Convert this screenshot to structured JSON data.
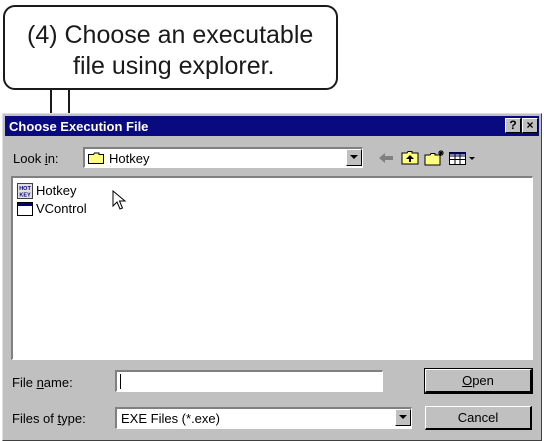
{
  "callout": {
    "line1": "(4)  Choose  an  executable",
    "line2": "file using explorer."
  },
  "dialog": {
    "title": "Choose Execution File",
    "help_button": "?",
    "close_button": "×",
    "lookin_label_pre": "Look ",
    "lookin_label_key": "i",
    "lookin_label_post": "n:",
    "lookin_value": "Hotkey",
    "files": [
      {
        "name": "Hotkey",
        "icon": "hotkey-app-icon"
      },
      {
        "name": "VControl",
        "icon": "window-app-icon"
      }
    ],
    "filename_label_pre": "File ",
    "filename_label_key": "n",
    "filename_label_post": "ame:",
    "filename_value": "",
    "filetype_label_pre": "Files of ",
    "filetype_label_key": "t",
    "filetype_label_post": "ype:",
    "filetype_value": "EXE Files (*.exe)",
    "open_key": "O",
    "open_rest": "pen",
    "cancel_button": "Cancel"
  }
}
